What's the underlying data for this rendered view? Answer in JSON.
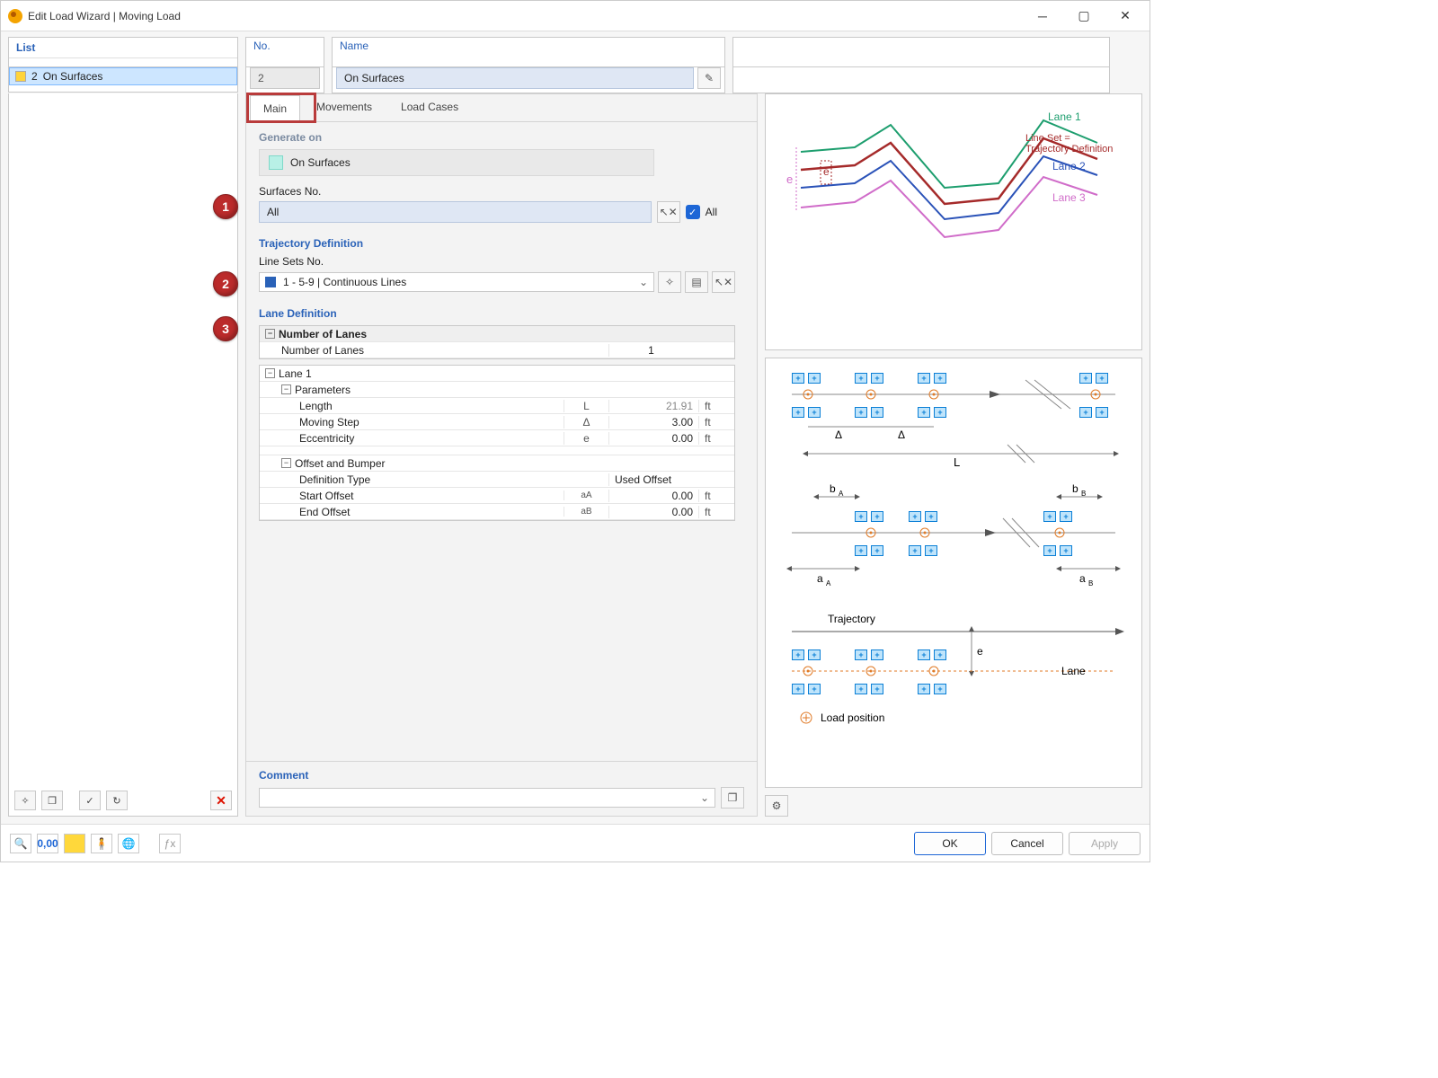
{
  "window": {
    "title": "Edit Load Wizard | Moving Load"
  },
  "list": {
    "header": "List",
    "item": {
      "no": "2",
      "label": "On Surfaces"
    }
  },
  "no_name": {
    "no_label": "No.",
    "no_value": "2",
    "name_label": "Name",
    "name_value": "On Surfaces"
  },
  "tabs": {
    "main": "Main",
    "movements": "Movements",
    "load_cases": "Load Cases"
  },
  "generate": {
    "section": "Generate on",
    "option": "On Surfaces",
    "surfaces_label": "Surfaces No.",
    "surfaces_value": "All",
    "all_label": "All"
  },
  "trajectory": {
    "section": "Trajectory Definition",
    "linesets_label": "Line Sets No.",
    "linesets_value": "1 - 5-9 | Continuous Lines"
  },
  "lane": {
    "section": "Lane Definition",
    "nlanes_hdr": "Number of Lanes",
    "nlanes_label": "Number of Lanes",
    "nlanes_value": "1",
    "lane1": "Lane 1",
    "params": "Parameters",
    "length": "Length",
    "length_sym": "L",
    "length_val": "21.91",
    "length_unit": "ft",
    "step": "Moving Step",
    "step_sym": "Δ",
    "step_val": "3.00",
    "step_unit": "ft",
    "ecc": "Eccentricity",
    "ecc_sym": "e",
    "ecc_val": "0.00",
    "ecc_unit": "ft",
    "off_hdr": "Offset and Bumper",
    "deftype": "Definition Type",
    "deftype_val": "Used Offset",
    "startoff": "Start Offset",
    "startoff_sym": "aA",
    "startoff_val": "0.00",
    "startoff_unit": "ft",
    "endoff": "End Offset",
    "endoff_sym": "aB",
    "endoff_val": "0.00",
    "endoff_unit": "ft"
  },
  "comment": {
    "label": "Comment"
  },
  "buttons": {
    "ok": "OK",
    "cancel": "Cancel",
    "apply": "Apply"
  },
  "callouts": {
    "c1": "1",
    "c2": "2",
    "c3": "3"
  },
  "diagrams": {
    "lane1": "Lane 1",
    "lane2": "Lane 2",
    "lane3": "Lane 3",
    "lineset": "Line Set =",
    "trajdef": "Trajectory Definition",
    "e": "e",
    "delta": "Δ",
    "L": "L",
    "bA": "b",
    "bAs": "A",
    "bB": "b",
    "bBs": "B",
    "aA": "a",
    "aAs": "A",
    "aB": "a",
    "aBs": "B",
    "trajectory": "Trajectory",
    "lane": "Lane",
    "loadpos": "Load position"
  }
}
